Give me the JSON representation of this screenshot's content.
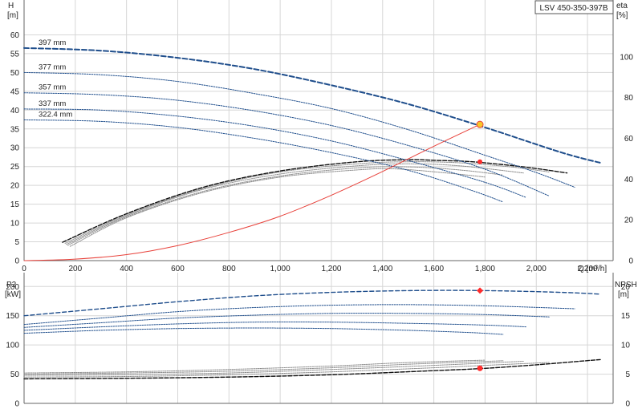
{
  "model_label": "LSV 450-350-397B",
  "colors": {
    "grid": "#d6d6d6",
    "axis": "#666666",
    "head_curves": "#1f4e8c",
    "selected": "#1f4e8c",
    "efficiency": "#111111",
    "npsh": "#111111",
    "system_curve": "#e8413a",
    "operating_point_fill": "#f7c62a",
    "marker_red": "#ff2b2b"
  },
  "chart_data": [
    {
      "type": "line",
      "panel": "head",
      "ylabel": "H",
      "yunit": "[m]",
      "y2label": "eta",
      "y2unit": "[%]",
      "xlabel": "Q [m³/h]",
      "xlim": [
        0,
        2300
      ],
      "ylim": [
        0,
        65
      ],
      "y2lim": [
        0,
        120
      ],
      "x_ticks": [
        "0",
        "200",
        "400",
        "600",
        "800",
        "1,000",
        "1,200",
        "1,400",
        "1,600",
        "1,800",
        "2,000",
        "2,200"
      ],
      "y_ticks": [
        "0",
        "5",
        "10",
        "15",
        "20",
        "25",
        "30",
        "35",
        "40",
        "45",
        "50",
        "55",
        "60"
      ],
      "y2_ticks": [
        "0",
        "20",
        "40",
        "60",
        "80",
        "100"
      ],
      "grid": true,
      "series": [
        {
          "name": "397 mm",
          "style": "selected",
          "x": [
            0,
            300,
            600,
            900,
            1200,
            1500,
            1800,
            2100,
            2250
          ],
          "y": [
            56.5,
            55.8,
            53.9,
            50.9,
            46.6,
            41.6,
            35.4,
            28.7,
            26.0
          ]
        },
        {
          "name": "377 mm",
          "style": "dotted",
          "x": [
            0,
            300,
            600,
            900,
            1200,
            1500,
            1800,
            2000,
            2150
          ],
          "y": [
            50.0,
            49.4,
            47.6,
            44.4,
            40.4,
            34.8,
            28.0,
            23.4,
            19.5
          ]
        },
        {
          "name": "357 mm",
          "style": "dotted",
          "x": [
            0,
            300,
            600,
            900,
            1200,
            1500,
            1800,
            2050
          ],
          "y": [
            44.6,
            44.1,
            42.6,
            39.8,
            35.9,
            30.6,
            24.3,
            17.2
          ]
        },
        {
          "name": "337 mm",
          "style": "dotted",
          "x": [
            0,
            300,
            600,
            900,
            1200,
            1500,
            1800,
            1960
          ],
          "y": [
            40.3,
            40.0,
            38.4,
            35.7,
            31.8,
            26.6,
            20.8,
            16.8
          ]
        },
        {
          "name": "322.4 mm",
          "style": "dotted",
          "x": [
            0,
            300,
            600,
            900,
            1200,
            1500,
            1750,
            1870
          ],
          "y": [
            37.4,
            37.0,
            35.4,
            32.5,
            28.7,
            24.0,
            18.6,
            15.6
          ]
        }
      ],
      "efficiency_series": [
        {
          "x": [
            150,
            400,
            700,
            1000,
            1300,
            1500,
            1600,
            1750,
            1950,
            2120
          ],
          "y": [
            9,
            23,
            36,
            44,
            48.5,
            49.5,
            49.2,
            48.5,
            46,
            43
          ]
        },
        {
          "x": [
            160,
            400,
            700,
            1000,
            1300,
            1500,
            1700,
            1900,
            2050
          ],
          "y": [
            8.5,
            22.5,
            35.5,
            43.5,
            47.5,
            48.5,
            48,
            46,
            43.5
          ]
        },
        {
          "x": [
            165,
            400,
            700,
            1000,
            1300,
            1500,
            1700,
            1950
          ],
          "y": [
            8,
            22,
            35,
            42.5,
            46.5,
            47.5,
            46.5,
            43
          ]
        },
        {
          "x": [
            170,
            400,
            700,
            1000,
            1300,
            1500,
            1700,
            1870
          ],
          "y": [
            7.5,
            21.5,
            34,
            41.5,
            45.5,
            46,
            44.5,
            42
          ]
        },
        {
          "x": [
            180,
            400,
            700,
            1000,
            1300,
            1450,
            1650,
            1800
          ],
          "y": [
            7,
            21,
            33.5,
            41,
            44.5,
            45,
            43,
            41
          ]
        }
      ],
      "system_curve": {
        "x": [
          0,
          200,
          400,
          600,
          800,
          1000,
          1200,
          1400,
          1600,
          1780
        ],
        "y": [
          0,
          0.4,
          1.6,
          4.0,
          7.5,
          11.8,
          17.4,
          23.7,
          30.4,
          36.2
        ]
      },
      "operating_point": {
        "x": 1780,
        "y": 36.2
      },
      "efficiency_point": {
        "x": 1780,
        "y": 48.5
      }
    },
    {
      "type": "line",
      "panel": "power_npsh",
      "ylabel": "P2",
      "yunit": "[kW]",
      "y2label": "NPSH",
      "y2unit": "[m]",
      "xlim": [
        0,
        2300
      ],
      "ylim": [
        0,
        210
      ],
      "y2lim": [
        0,
        21
      ],
      "y_ticks": [
        "0",
        "50",
        "100",
        "150",
        "200"
      ],
      "y2_ticks": [
        "0",
        "5",
        "10",
        "15",
        "20"
      ],
      "grid": true,
      "power_series": [
        {
          "name": "397 mm",
          "style": "selected",
          "x": [
            0,
            300,
            600,
            900,
            1200,
            1500,
            1800,
            2100,
            2250
          ],
          "y": [
            150,
            162,
            174,
            184,
            190,
            193,
            193,
            190,
            187
          ]
        },
        {
          "name": "377 mm",
          "style": "dotted",
          "x": [
            0,
            300,
            600,
            900,
            1200,
            1500,
            1800,
            2150
          ],
          "y": [
            135,
            146,
            157,
            164,
            168,
            169,
            167,
            162
          ]
        },
        {
          "name": "357 mm",
          "style": "dotted",
          "x": [
            0,
            300,
            600,
            900,
            1200,
            1500,
            1800,
            2050
          ],
          "y": [
            130,
            138,
            146,
            151,
            154,
            154,
            152,
            148
          ]
        },
        {
          "name": "337 mm",
          "style": "dotted",
          "x": [
            0,
            300,
            600,
            900,
            1200,
            1500,
            1800,
            1960
          ],
          "y": [
            125,
            131,
            136,
            139,
            139,
            137,
            134,
            131
          ]
        },
        {
          "name": "322.4 mm",
          "style": "dotted",
          "x": [
            0,
            300,
            600,
            900,
            1200,
            1500,
            1750,
            1870
          ],
          "y": [
            120,
            125,
            128,
            129,
            128,
            125,
            121,
            118
          ]
        }
      ],
      "npsh_series": [
        {
          "x": [
            0,
            400,
            800,
            1200,
            1600,
            1800,
            2000,
            2250
          ],
          "y": [
            4.2,
            4.3,
            4.5,
            4.9,
            5.6,
            6.0,
            6.6,
            7.5
          ]
        },
        {
          "x": [
            0,
            400,
            800,
            1200,
            1600,
            1800,
            2050
          ],
          "y": [
            4.5,
            4.6,
            4.9,
            5.4,
            6.1,
            6.5,
            7.0
          ]
        },
        {
          "x": [
            0,
            400,
            800,
            1200,
            1600,
            1800,
            1950
          ],
          "y": [
            4.8,
            4.9,
            5.2,
            5.8,
            6.5,
            6.9,
            7.2
          ]
        },
        {
          "x": [
            0,
            400,
            800,
            1200,
            1500,
            1750,
            1870
          ],
          "y": [
            5.0,
            5.2,
            5.5,
            6.1,
            6.7,
            7.1,
            7.3
          ]
        },
        {
          "x": [
            0,
            400,
            800,
            1200,
            1450,
            1650,
            1800
          ],
          "y": [
            5.2,
            5.4,
            5.8,
            6.4,
            6.9,
            7.2,
            7.4
          ]
        }
      ],
      "power_point": {
        "x": 1780,
        "y": 193
      },
      "npsh_point": {
        "x": 1780,
        "y": 6.0
      }
    }
  ]
}
